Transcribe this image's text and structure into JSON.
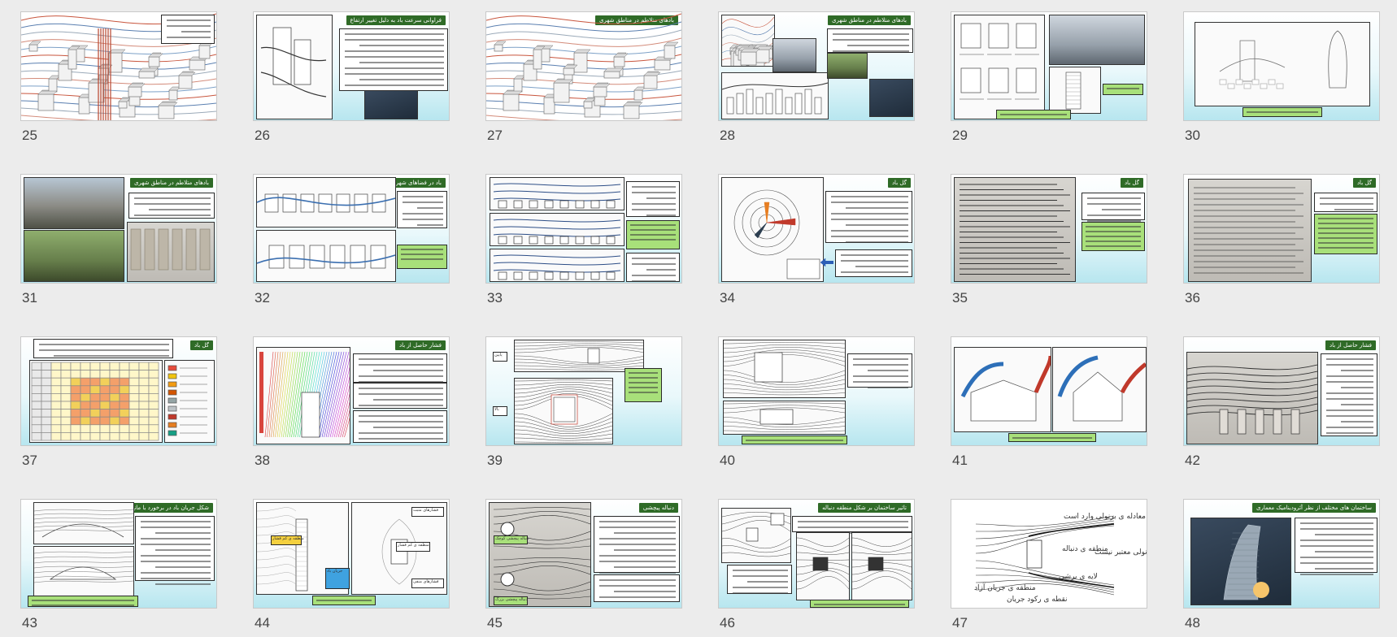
{
  "slides": [
    {
      "number": "25",
      "title": ""
    },
    {
      "number": "26",
      "title": "فراوانی سرعت باد به دلیل تغییر ارتفاع"
    },
    {
      "number": "27",
      "title": "بادهای متلاطم در مناطق شهری"
    },
    {
      "number": "28",
      "title": "بادهای متلاطم در مناطق شهری"
    },
    {
      "number": "29",
      "title": ""
    },
    {
      "number": "30",
      "title": ""
    },
    {
      "number": "31",
      "title": "بادهای متلاطم در مناطق شهری"
    },
    {
      "number": "32",
      "title": "باد در فضاهای شهری"
    },
    {
      "number": "33",
      "title": ""
    },
    {
      "number": "34",
      "title": "گل باد"
    },
    {
      "number": "35",
      "title": "گل باد"
    },
    {
      "number": "36",
      "title": "گل باد"
    },
    {
      "number": "37",
      "title": "گل باد"
    },
    {
      "number": "38",
      "title": "فشار حاصل از باد"
    },
    {
      "number": "39",
      "title": ""
    },
    {
      "number": "40",
      "title": ""
    },
    {
      "number": "41",
      "title": ""
    },
    {
      "number": "42",
      "title": "فشار حاصل از باد"
    },
    {
      "number": "43",
      "title": "شکل جریان باد در برخورد با مانع"
    },
    {
      "number": "44",
      "title": ""
    },
    {
      "number": "45",
      "title": "دنباله پیچشی"
    },
    {
      "number": "46",
      "title": "تاثیر ساختمان بر شکل منطقه دنباله"
    },
    {
      "number": "47",
      "title": ""
    },
    {
      "number": "48",
      "title": "ساختمان های مختلف از نظر آئرودینامیک معماری"
    }
  ],
  "slide47": {
    "labels": [
      "معادله ی برنولی وارد است",
      "منطقه ی دنباله",
      "معادله ی برنولی معتبر نیست",
      "لایه ی برشی",
      "منطقه ی جریان آزاد",
      "نقطه ی رکود جریان"
    ]
  },
  "slide39": {
    "labels": [
      "پایین",
      "بالا"
    ]
  },
  "slide44": {
    "labels": [
      "منطقه ی کم فشار",
      "منطقه ی کم فشار",
      "فشارهای مثبت",
      "فشارهای منفی",
      "جریان باد"
    ]
  },
  "slide45": {
    "labels": [
      "دنباله پیچشی کوچک",
      "دنباله پیچشی بزرگ"
    ]
  },
  "colors": {
    "title_bg": "#2f6b27",
    "callout_green": "#a8e07a",
    "slide_gradient_bottom": "#b7e6ef",
    "page_bg": "#ececec"
  }
}
